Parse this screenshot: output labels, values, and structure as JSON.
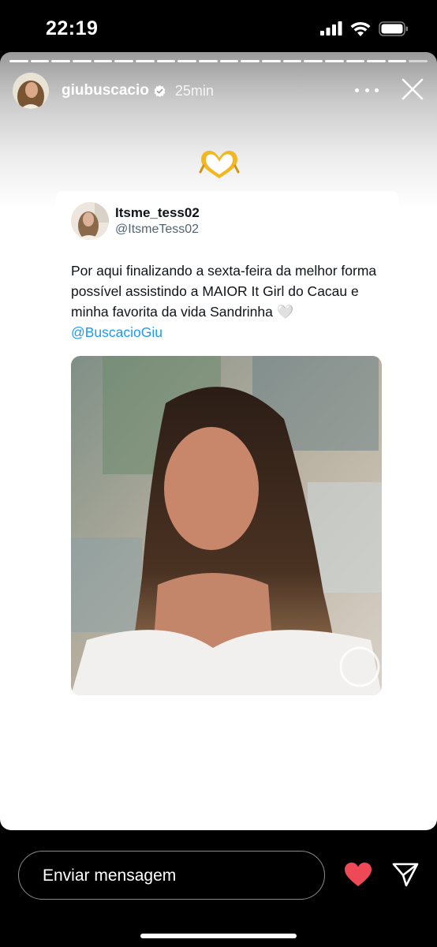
{
  "status_bar": {
    "time": "22:19",
    "icons": [
      "cellular-signal-icon",
      "wifi-icon",
      "battery-icon"
    ]
  },
  "story": {
    "progress_segments": 20,
    "progress_completed": 19,
    "header": {
      "username": "giubuscacio",
      "verified": true,
      "time_ago": "25min"
    },
    "sticker": "heart-hands-emoji",
    "tweet": {
      "display_name": "Itsme_tess02",
      "handle": "@ItsmeTess02",
      "text": "Por aqui finalizando a sexta-feira da melhor forma possível assistindo a MAIOR It Girl do Cacau e minha favorita da vida Sandrinha 🤍",
      "mention": "@BuscacioGiu"
    }
  },
  "reply_bar": {
    "placeholder": "Enviar mensagem",
    "like_color": "#ed4956"
  }
}
